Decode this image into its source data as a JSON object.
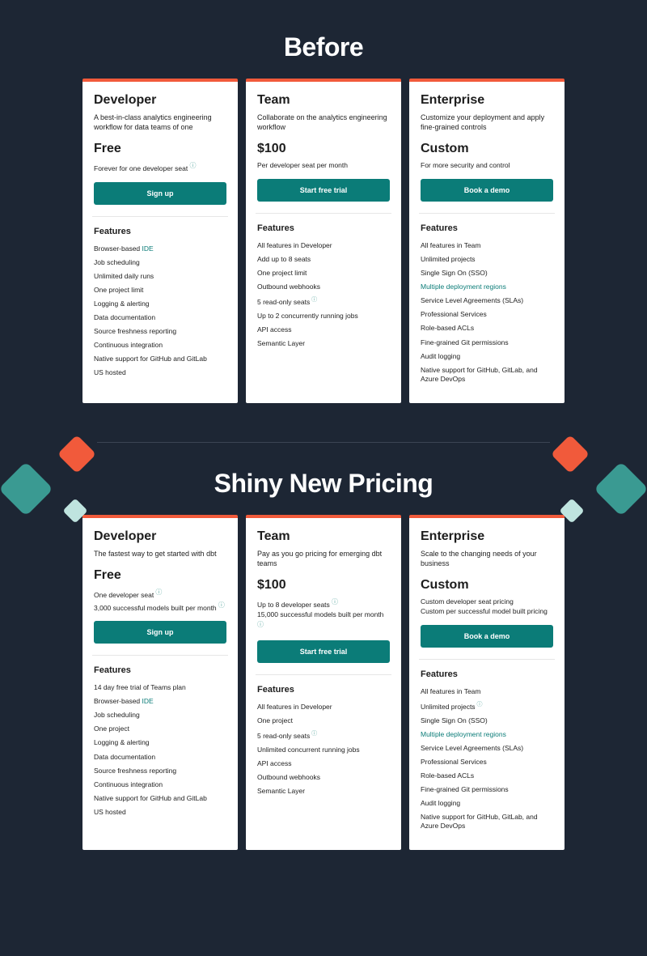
{
  "before": {
    "heading": "Before",
    "plans": [
      {
        "name": "Developer",
        "tagline": "A best-in-class analytics engineering workflow for data teams of one",
        "price": "Free",
        "caption1": "Forever for one developer seat",
        "caption1_info": true,
        "cta": "Sign up",
        "features_heading": "Features",
        "features": [
          {
            "text_pre": "Browser-based ",
            "link": "IDE"
          },
          {
            "text": "Job scheduling"
          },
          {
            "text": "Unlimited daily runs"
          },
          {
            "text": "One project limit"
          },
          {
            "text": "Logging & alerting"
          },
          {
            "text": "Data documentation"
          },
          {
            "text": "Source freshness reporting"
          },
          {
            "text": "Continuous integration"
          },
          {
            "text": "Native support for GitHub and GitLab"
          },
          {
            "text": "US hosted"
          }
        ]
      },
      {
        "name": "Team",
        "tagline": "Collaborate on the analytics engineering workflow",
        "price": "$100",
        "caption1": "Per developer seat per month",
        "cta": "Start free trial",
        "features_heading": "Features",
        "features": [
          {
            "text": "All features in Developer"
          },
          {
            "text": "Add up to 8 seats"
          },
          {
            "text": "One project limit"
          },
          {
            "text": "Outbound webhooks"
          },
          {
            "text": "5 read-only seats",
            "info": true
          },
          {
            "text": "Up to 2 concurrently running jobs"
          },
          {
            "text": "API access"
          },
          {
            "text": "Semantic Layer"
          }
        ]
      },
      {
        "name": "Enterprise",
        "tagline": "Customize your deployment and apply fine-grained controls",
        "price": "Custom",
        "caption1": "For more security and control",
        "cta": "Book a demo",
        "features_heading": "Features",
        "features": [
          {
            "text": "All features in Team"
          },
          {
            "text": "Unlimited projects"
          },
          {
            "text": "Single Sign On (SSO)"
          },
          {
            "text": "Multiple deployment regions",
            "highlight": true
          },
          {
            "text": "Service Level Agreements (SLAs)"
          },
          {
            "text": "Professional Services"
          },
          {
            "text": "Role-based ACLs"
          },
          {
            "text": "Fine-grained Git permissions"
          },
          {
            "text": "Audit logging"
          },
          {
            "text": "Native support for GitHub, GitLab, and Azure DevOps"
          }
        ]
      }
    ]
  },
  "after": {
    "heading": "Shiny New Pricing",
    "plans": [
      {
        "name": "Developer",
        "tagline": "The fastest way to get started with dbt",
        "price": "Free",
        "caption1": "One developer seat",
        "caption1_info": true,
        "caption2": "3,000 successful models built per month",
        "caption2_info": true,
        "cta": "Sign up",
        "features_heading": "Features",
        "features": [
          {
            "text": "14 day free trial of Teams plan"
          },
          {
            "text_pre": "Browser-based ",
            "link": "IDE"
          },
          {
            "text": "Job scheduling"
          },
          {
            "text": "One project"
          },
          {
            "text": "Logging & alerting"
          },
          {
            "text": "Data documentation"
          },
          {
            "text": "Source freshness reporting"
          },
          {
            "text": "Continuous integration"
          },
          {
            "text": "Native support for GitHub and GitLab"
          },
          {
            "text": "US hosted"
          }
        ]
      },
      {
        "name": "Team",
        "tagline": "Pay as you go pricing for emerging dbt teams",
        "price": "$100",
        "caption1": "Up to 8 developer seats",
        "caption1_info": true,
        "caption2": "15,000 successful models built per month",
        "caption2_info": true,
        "cta": "Start free trial",
        "features_heading": "Features",
        "features": [
          {
            "text": "All features in Developer"
          },
          {
            "text": "One project"
          },
          {
            "text": "5 read-only seats",
            "info": true
          },
          {
            "text": "Unlimited concurrent running jobs"
          },
          {
            "text": "API access"
          },
          {
            "text": "Outbound webhooks"
          },
          {
            "text": "Semantic Layer"
          }
        ]
      },
      {
        "name": "Enterprise",
        "tagline": "Scale to the changing needs of your business",
        "price": "Custom",
        "caption1": "Custom developer seat pricing",
        "caption2": "Custom per successful model built pricing",
        "cta": "Book a demo",
        "features_heading": "Features",
        "features": [
          {
            "text": "All features in Team"
          },
          {
            "text": "Unlimited projects",
            "info": true
          },
          {
            "text": "Single Sign On (SSO)"
          },
          {
            "text": "Multiple deployment regions",
            "highlight": true
          },
          {
            "text": "Service Level Agreements (SLAs)"
          },
          {
            "text": "Professional Services"
          },
          {
            "text": "Role-based ACLs"
          },
          {
            "text": "Fine-grained Git permissions"
          },
          {
            "text": "Audit logging"
          },
          {
            "text": "Native support for GitHub, GitLab, and Azure DevOps"
          }
        ]
      }
    ]
  }
}
